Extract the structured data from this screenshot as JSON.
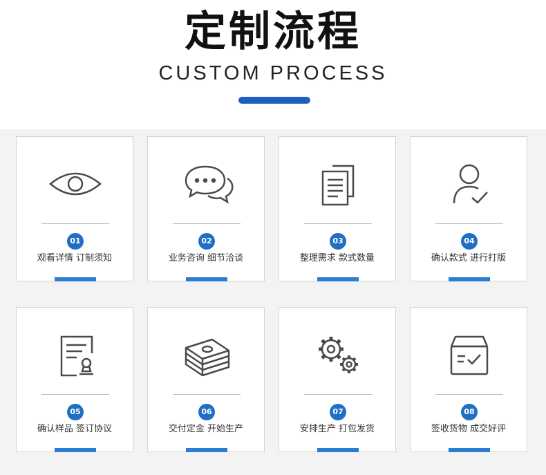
{
  "header": {
    "title": "定制流程",
    "subtitle": "CUSTOM PROCESS",
    "accent_color": "#1f5fbf"
  },
  "steps": [
    {
      "number": "01",
      "label": "观看详情 订制须知",
      "icon": "eye-icon"
    },
    {
      "number": "02",
      "label": "业务咨询 细节洽谈",
      "icon": "chat-bubbles-icon"
    },
    {
      "number": "03",
      "label": "整理需求 款式数量",
      "icon": "documents-icon"
    },
    {
      "number": "04",
      "label": "确认款式 进行打版",
      "icon": "user-check-icon"
    },
    {
      "number": "05",
      "label": "确认样品 签订协议",
      "icon": "contract-icon"
    },
    {
      "number": "06",
      "label": "交付定金 开始生产",
      "icon": "money-stack-icon"
    },
    {
      "number": "07",
      "label": "安排生产 打包发货",
      "icon": "gears-icon"
    },
    {
      "number": "08",
      "label": "签收货物 成交好评",
      "icon": "box-check-icon"
    }
  ]
}
